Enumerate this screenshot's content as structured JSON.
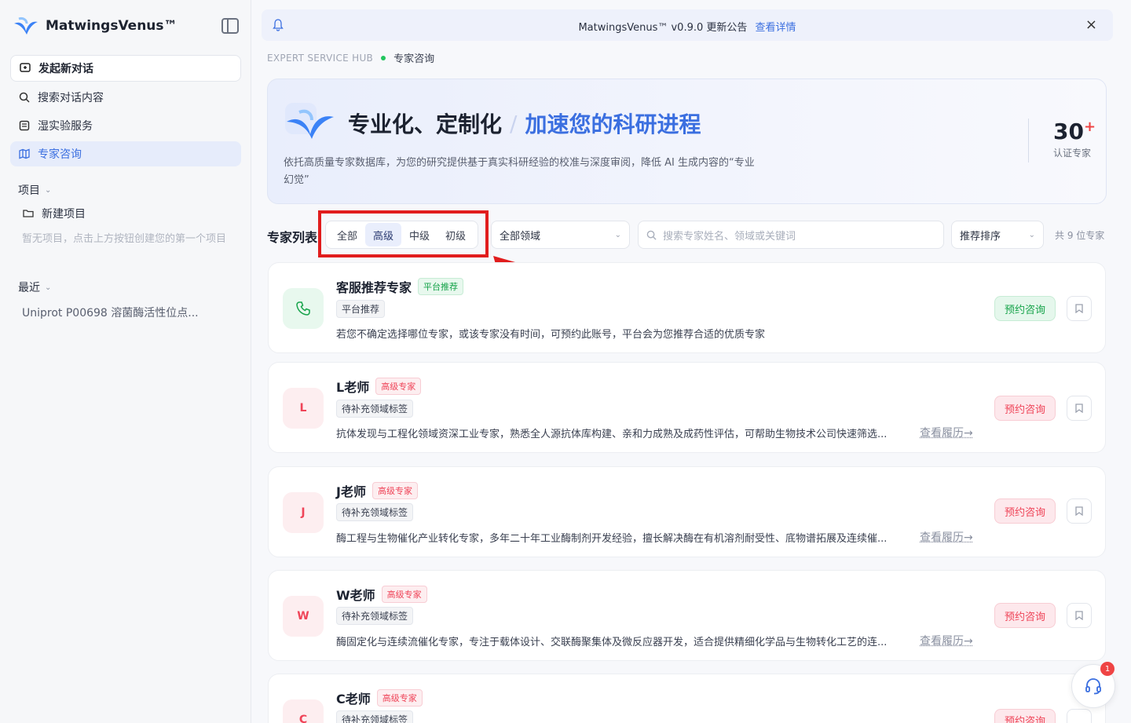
{
  "app": {
    "name": "MatwingsVenus™"
  },
  "sidebar": {
    "new_chat": "发起新对话",
    "items": [
      {
        "label": "搜索对话内容"
      },
      {
        "label": "湿实验服务"
      },
      {
        "label": "专家咨询"
      }
    ],
    "projects_title": "项目",
    "new_project": "新建项目",
    "projects_hint": "暂无项目，点击上方按钮创建您的第一个项目",
    "recent_title": "最近",
    "recent_items": [
      "Uniprot P00698 溶菌酶活性位点..."
    ]
  },
  "banner": {
    "text": "MatwingsVenus™ v0.9.0 更新公告",
    "link": "查看详情"
  },
  "breadcrumb": {
    "en": "EXPERT SERVICE HUB",
    "cn": "专家咨询"
  },
  "hero": {
    "title": "专业化、定制化",
    "slash": "/",
    "accent": "加速您的科研进程",
    "desc": "依托高质量专家数据库，为您的研究提供基于真实科研经验的校准与深度审阅，降低 AI 生成内容的“专业幻觉”",
    "stat_num": "30",
    "stat_plus": "+",
    "stat_label": "认证专家"
  },
  "list": {
    "title": "专家列表",
    "tabs": [
      "全部",
      "高级",
      "中级",
      "初级"
    ],
    "active_tab": "高级",
    "domain_select": "全部领域",
    "search_placeholder": "搜索专家姓名、领域或关键词",
    "sort_select": "推荐排序",
    "count": "共 9 位专家"
  },
  "experts": [
    {
      "avatar": "phone",
      "name": "客服推荐专家",
      "badge": "平台推荐",
      "tag": "平台推荐",
      "desc": "若您不确定选择哪位专家，或该专家没有时间，可预约此账号，平台会为您推荐合适的优质专家",
      "resume": "",
      "button": "预约咨询"
    },
    {
      "avatar": "L",
      "name": "L老师",
      "badge": "高级专家",
      "tag": "待补充领域标签",
      "desc": "抗体发现与工程化领域资深工业专家，熟悉全人源抗体库构建、亲和力成熟及成药性评估，可帮助生物技术公司快速筛选...",
      "resume": "查看履历→",
      "button": "预约咨询"
    },
    {
      "avatar": "J",
      "name": "J老师",
      "badge": "高级专家",
      "tag": "待补充领域标签",
      "desc": "酶工程与生物催化产业转化专家，多年二十年工业酶制剂开发经验，擅长解决酶在有机溶剂耐受性、底物谱拓展及连续催...",
      "resume": "查看履历→",
      "button": "预约咨询"
    },
    {
      "avatar": "W",
      "name": "W老师",
      "badge": "高级专家",
      "tag": "待补充领域标签",
      "desc": "酶固定化与连续流催化专家，专注于载体设计、交联酶聚集体及微反应器开发，适合提供精细化学品与生物转化工艺的连...",
      "resume": "查看履历→",
      "button": "预约咨询"
    },
    {
      "avatar": "C",
      "name": "C老师",
      "badge": "高级专家",
      "tag": "待补充领域标签",
      "desc": "",
      "resume": "",
      "button": "预约咨询"
    }
  ],
  "support_badge": "1"
}
